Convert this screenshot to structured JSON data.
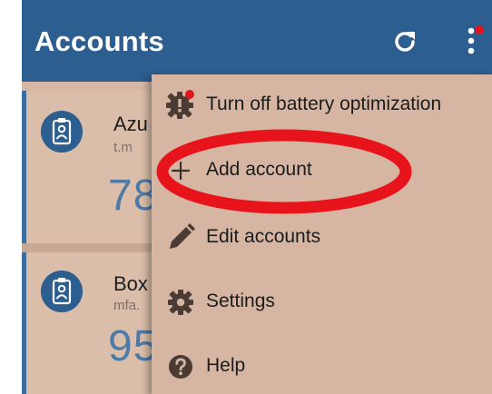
{
  "appbar": {
    "title": "Accounts",
    "refresh_icon": "refresh-icon",
    "more_icon": "more-vert-icon"
  },
  "accounts": [
    {
      "name": "Azu",
      "user": "t.m",
      "code": "78",
      "icon": "id-badge-icon"
    },
    {
      "name": "Box",
      "user": "mfa.",
      "code": "95",
      "icon": "id-badge-icon"
    }
  ],
  "menu": {
    "items": [
      {
        "label": "Turn off battery optimization",
        "icon": "gear-alert-icon"
      },
      {
        "label": "Add account",
        "icon": "plus-icon"
      },
      {
        "label": "Edit accounts",
        "icon": "pencil-icon"
      },
      {
        "label": "Settings",
        "icon": "gear-icon"
      },
      {
        "label": "Help",
        "icon": "help-icon"
      }
    ]
  },
  "colors": {
    "appbar": "#2d5e90",
    "background": "#d7b7a4",
    "accent": "#4d7aa6",
    "notification_dot": "#e0161f",
    "annotation": "#e8141c"
  }
}
